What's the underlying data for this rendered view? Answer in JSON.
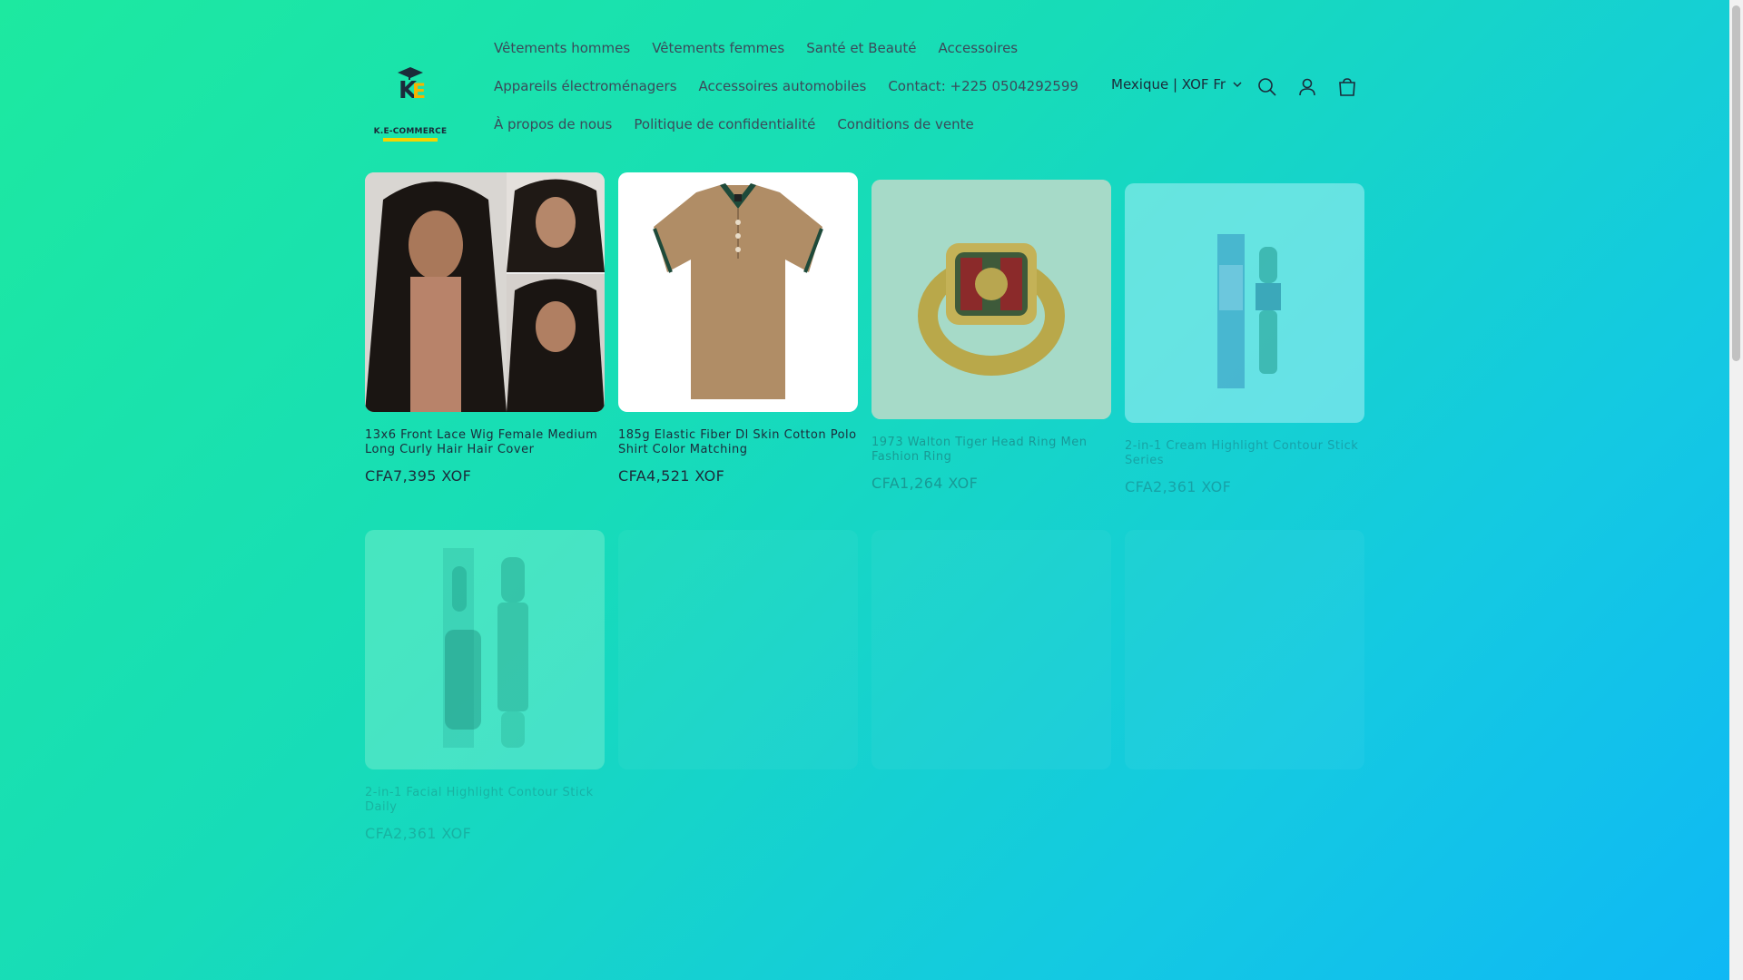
{
  "logo": {
    "text": "K.E-COMMERCE"
  },
  "nav": {
    "rows": [
      [
        "Vêtements hommes",
        "Vêtements femmes",
        "Santé et Beauté",
        "Accessoires"
      ],
      [
        "Appareils électroménagers",
        "Accessoires automobiles",
        "Contact: +225 0504292599"
      ],
      [
        "À propos de nous",
        "Politique de confidentialité",
        "Conditions de vente"
      ]
    ]
  },
  "locale": {
    "label": "Mexique | XOF Fr"
  },
  "icons": {
    "search": "search-icon",
    "account": "account-icon",
    "cart": "cart-icon"
  },
  "products": [
    {
      "title": "13x6 Front Lace Wig Female Medium Long Curly Hair Hair Cover",
      "price": "CFA7,395 XOF",
      "image": "wig-image"
    },
    {
      "title": "185g Elastic Fiber Dl Skin Cotton Polo Shirt Color Matching",
      "price": "CFA4,521 XOF",
      "image": "polo-shirt-image"
    },
    {
      "title": "1973 Walton Tiger Head Ring Men Fashion Ring",
      "price": "CFA1,264 XOF",
      "image": "ring-image"
    },
    {
      "title": "2-in-1 Cream Highlight Contour Stick Series",
      "price": "CFA2,361 XOF",
      "image": "contour-stick-image"
    },
    {
      "title": "2-in-1 Facial Highlight Contour Stick Daily",
      "price": "CFA2,361 XOF",
      "image": "facial-contour-stick-image"
    }
  ],
  "colors": {
    "gradient_start": "#1de9a0",
    "gradient_end": "#0fb8f5",
    "text": "#1c2b3a",
    "nav_text": "#3b4a5a"
  }
}
